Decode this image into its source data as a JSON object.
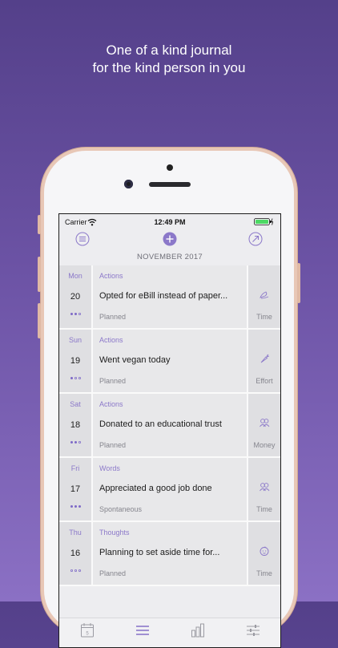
{
  "headline": {
    "line1": "One of a kind journal",
    "line2": "for the kind person in you"
  },
  "status_bar": {
    "carrier": "Carrier",
    "time": "12:49 PM"
  },
  "navbar": {
    "month": "NOVEMBER 2017",
    "left_icon": "list-menu-icon",
    "center_icon": "add-plus-icon",
    "right_icon": "arrow-up-right-icon"
  },
  "entries": [
    {
      "day": "Mon",
      "date": "20",
      "category": "Actions",
      "title": "Opted for eBill instead of paper...",
      "status": "Planned",
      "type": "Time",
      "type_icon": "leaf-hand-icon",
      "dots": [
        "full",
        "full",
        "empty"
      ]
    },
    {
      "day": "Sun",
      "date": "19",
      "category": "Actions",
      "title": "Went vegan today",
      "status": "Planned",
      "type": "Effort",
      "type_icon": "carrot-icon",
      "dots": [
        "full",
        "empty",
        "empty"
      ]
    },
    {
      "day": "Sat",
      "date": "18",
      "category": "Actions",
      "title": "Donated to an educational trust",
      "status": "Planned",
      "type": "Money",
      "type_icon": "group-icon",
      "dots": [
        "full",
        "full",
        "empty"
      ]
    },
    {
      "day": "Fri",
      "date": "17",
      "category": "Words",
      "title": "Appreciated a good job done",
      "status": "Spontaneous",
      "type": "Time",
      "type_icon": "group-icon",
      "dots": [
        "full",
        "full",
        "full"
      ]
    },
    {
      "day": "Thu",
      "date": "16",
      "category": "Thoughts",
      "title": "Planning to set aside time for...",
      "status": "Planned",
      "type": "Time",
      "type_icon": "baby-icon",
      "dots": [
        "empty",
        "empty",
        "empty"
      ]
    }
  ],
  "tab_bar": {
    "tabs": [
      {
        "name": "calendar",
        "icon": "calendar-icon",
        "badge": "5",
        "active": false
      },
      {
        "name": "list",
        "icon": "list-icon",
        "active": true
      },
      {
        "name": "stats",
        "icon": "bar-chart-icon",
        "active": false
      },
      {
        "name": "settings",
        "icon": "sliders-icon",
        "active": false
      }
    ]
  },
  "colors": {
    "accent": "#8b78c9",
    "background_top": "#54408a",
    "background_bottom": "#8b70c4"
  }
}
